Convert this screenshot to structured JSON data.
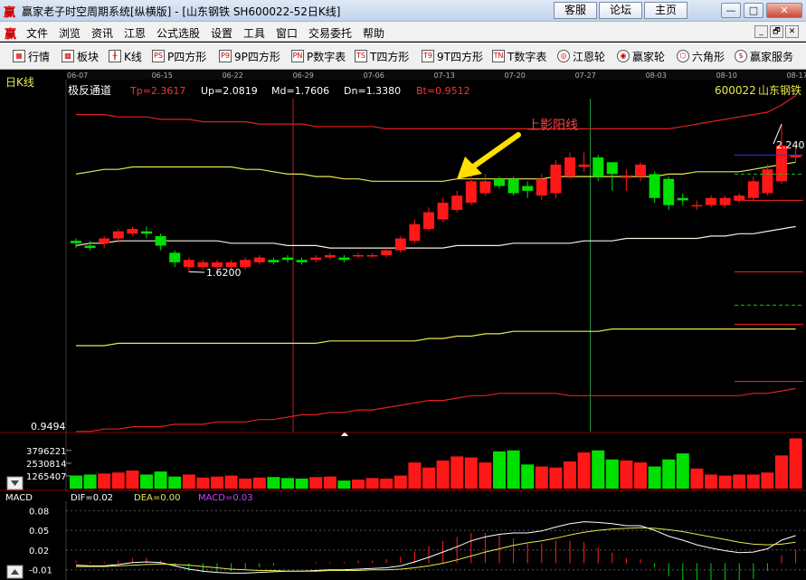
{
  "window": {
    "logo": "赢",
    "title": "赢家老子时空周期系统[纵横版] - [山东钢铁  SH600022-52日K线]",
    "buttons": [
      "客服",
      "论坛",
      "主页"
    ],
    "controls": [
      "—",
      "□",
      "✕"
    ]
  },
  "menu": {
    "logo": "赢",
    "items": [
      "文件",
      "浏览",
      "资讯",
      "江恩",
      "公式选股",
      "设置",
      "工具",
      "窗口",
      "交易委托",
      "帮助"
    ],
    "mdi": [
      "_",
      "🗗",
      "✕"
    ]
  },
  "toolbar": {
    "items": [
      {
        "icon": "grid-icon",
        "glyph": "▦",
        "label": "行情"
      },
      {
        "icon": "blocks-icon",
        "glyph": "▩",
        "label": "板块"
      },
      {
        "icon": "candles-icon",
        "glyph": "╫",
        "label": "K线"
      },
      {
        "icon": "p-square-icon",
        "glyph": "PS",
        "label": "P四方形"
      },
      {
        "icon": "p9-square-icon",
        "glyph": "P9",
        "label": "9P四方形"
      },
      {
        "icon": "pn-table-icon",
        "glyph": "PN",
        "label": "P数字表"
      },
      {
        "icon": "t-square-icon",
        "glyph": "TS",
        "label": "T四方形"
      },
      {
        "icon": "t9-square-icon",
        "glyph": "T9",
        "label": "9T四方形"
      },
      {
        "icon": "tn-table-icon",
        "glyph": "TN",
        "label": "T数字表"
      },
      {
        "icon": "gann-wheel-icon",
        "glyph": "◎",
        "label": "江恩轮"
      },
      {
        "icon": "winner-wheel-icon",
        "glyph": "◉",
        "label": "赢家轮"
      },
      {
        "icon": "hexagon-icon",
        "glyph": "⬡",
        "label": "六角形"
      },
      {
        "icon": "dollar-icon",
        "glyph": "$",
        "label": "赢家服务"
      }
    ]
  },
  "main_chart": {
    "panel_label": "日K线",
    "indicator_name": "极反通道",
    "params": [
      {
        "label": "Tp=2.3617",
        "color": "#ff3030"
      },
      {
        "label": "Up=2.0819",
        "color": "#ffffff"
      },
      {
        "label": "Md=1.7606",
        "color": "#ffffff"
      },
      {
        "label": "Dn=1.3380",
        "color": "#ffffff"
      },
      {
        "label": "Bt=0.9512",
        "color": "#ff3030"
      }
    ],
    "stock_code": "600022",
    "stock_name": "山东钢铁",
    "date_ticks": [
      "06-07",
      "06-15",
      "06-22",
      "06-29",
      "07-06",
      "07-13",
      "07-20",
      "07-27",
      "08-03",
      "08-10",
      "08-17"
    ],
    "annotation": "上影阳线",
    "low_label": "1.6200",
    "high_label": "2.240",
    "bottom_price": "0.9494",
    "colors": {
      "up": "#ff1818",
      "down": "#00e000",
      "outer": "#e02020",
      "inner": "#e8e850",
      "mid": "#f0f0e0",
      "arrow": "#ffe000",
      "annotation": "#ff4040"
    }
  },
  "chart_data": [
    {
      "type": "candlestick",
      "x": [
        "06-07",
        "06-08",
        "06-09",
        "06-12",
        "06-13",
        "06-14",
        "06-15",
        "06-16",
        "06-19",
        "06-20",
        "06-21",
        "06-22",
        "06-23",
        "06-26",
        "06-27",
        "06-28",
        "06-29",
        "06-30",
        "07-03",
        "07-04",
        "07-05",
        "07-06",
        "07-07",
        "07-10",
        "07-11",
        "07-12",
        "07-13",
        "07-14",
        "07-17",
        "07-18",
        "07-19",
        "07-20",
        "07-21",
        "07-24",
        "07-25",
        "07-26",
        "07-27",
        "07-28",
        "07-31",
        "08-01",
        "08-02",
        "08-03",
        "08-04",
        "08-07",
        "08-08",
        "08-09",
        "08-10",
        "08-11",
        "08-14",
        "08-15",
        "08-16",
        "08-17"
      ],
      "open": [
        1.75,
        1.73,
        1.74,
        1.76,
        1.78,
        1.79,
        1.77,
        1.7,
        1.64,
        1.64,
        1.64,
        1.64,
        1.64,
        1.66,
        1.67,
        1.68,
        1.67,
        1.67,
        1.68,
        1.68,
        1.69,
        1.69,
        1.69,
        1.71,
        1.75,
        1.8,
        1.84,
        1.88,
        1.91,
        1.95,
        2.01,
        2.01,
        1.98,
        1.94,
        1.95,
        2.02,
        2.06,
        2.1,
        2.08,
        2.02,
        2.02,
        2.03,
        2.01,
        1.93,
        1.9,
        1.9,
        1.9,
        1.92,
        1.93,
        1.95,
        2.0,
        2.1
      ],
      "close": [
        1.74,
        1.72,
        1.76,
        1.79,
        1.8,
        1.78,
        1.73,
        1.66,
        1.67,
        1.66,
        1.66,
        1.66,
        1.67,
        1.68,
        1.66,
        1.67,
        1.66,
        1.68,
        1.69,
        1.67,
        1.69,
        1.69,
        1.71,
        1.76,
        1.82,
        1.87,
        1.91,
        1.94,
        2.0,
        2.0,
        1.98,
        1.95,
        1.96,
        2.01,
        2.07,
        2.1,
        2.07,
        2.02,
        2.03,
        2.02,
        2.07,
        1.93,
        1.9,
        1.92,
        1.9,
        1.93,
        1.93,
        1.94,
        2.0,
        2.05,
        2.15,
        2.11
      ],
      "high": [
        1.76,
        1.75,
        1.77,
        1.8,
        1.81,
        1.81,
        1.78,
        1.71,
        1.68,
        1.67,
        1.67,
        1.67,
        1.68,
        1.69,
        1.68,
        1.69,
        1.68,
        1.69,
        1.7,
        1.69,
        1.7,
        1.7,
        1.72,
        1.77,
        1.84,
        1.89,
        1.93,
        1.96,
        2.03,
        2.03,
        2.02,
        2.02,
        2.0,
        2.03,
        2.09,
        2.12,
        2.12,
        2.11,
        2.06,
        2.05,
        2.08,
        2.04,
        2.02,
        1.95,
        1.92,
        1.94,
        1.94,
        1.95,
        2.02,
        2.07,
        2.24,
        2.14
      ],
      "low": [
        1.72,
        1.71,
        1.72,
        1.74,
        1.77,
        1.76,
        1.71,
        1.64,
        1.62,
        1.63,
        1.63,
        1.63,
        1.63,
        1.65,
        1.65,
        1.66,
        1.65,
        1.66,
        1.67,
        1.66,
        1.68,
        1.68,
        1.68,
        1.7,
        1.74,
        1.79,
        1.83,
        1.87,
        1.9,
        1.94,
        1.97,
        1.94,
        1.93,
        1.92,
        1.93,
        2.01,
        2.04,
        2.0,
        1.96,
        1.96,
        2.0,
        1.91,
        1.88,
        1.9,
        1.88,
        1.89,
        1.89,
        1.91,
        1.92,
        1.94,
        1.99,
        2.08
      ],
      "channels": {
        "Tp": [
          2.28,
          2.28,
          2.28,
          2.27,
          2.27,
          2.27,
          2.26,
          2.26,
          2.26,
          2.25,
          2.25,
          2.25,
          2.25,
          2.24,
          2.24,
          2.24,
          2.24,
          2.23,
          2.23,
          2.23,
          2.23,
          2.23,
          2.22,
          2.22,
          2.22,
          2.22,
          2.22,
          2.22,
          2.22,
          2.22,
          2.22,
          2.22,
          2.22,
          2.22,
          2.22,
          2.22,
          2.22,
          2.22,
          2.22,
          2.22,
          2.22,
          2.22,
          2.22,
          2.23,
          2.24,
          2.25,
          2.26,
          2.27,
          2.28,
          2.29,
          2.32,
          2.36
        ],
        "Up": [
          2.03,
          2.04,
          2.05,
          2.05,
          2.06,
          2.06,
          2.06,
          2.06,
          2.06,
          2.06,
          2.06,
          2.06,
          2.05,
          2.05,
          2.04,
          2.03,
          2.03,
          2.02,
          2.02,
          2.01,
          2.01,
          2.0,
          2.0,
          2.0,
          2.0,
          2.0,
          2.0,
          2.01,
          2.01,
          2.01,
          2.01,
          2.01,
          2.01,
          2.01,
          2.02,
          2.02,
          2.02,
          2.02,
          2.02,
          2.02,
          2.02,
          2.02,
          2.03,
          2.03,
          2.04,
          2.04,
          2.04,
          2.04,
          2.05,
          2.06,
          2.07,
          2.08
        ],
        "Md": [
          1.73,
          1.74,
          1.74,
          1.75,
          1.75,
          1.75,
          1.75,
          1.75,
          1.75,
          1.75,
          1.75,
          1.74,
          1.74,
          1.74,
          1.74,
          1.73,
          1.73,
          1.73,
          1.72,
          1.72,
          1.72,
          1.72,
          1.72,
          1.72,
          1.72,
          1.72,
          1.72,
          1.73,
          1.73,
          1.73,
          1.73,
          1.74,
          1.74,
          1.74,
          1.74,
          1.74,
          1.75,
          1.75,
          1.75,
          1.76,
          1.76,
          1.76,
          1.76,
          1.76,
          1.76,
          1.77,
          1.77,
          1.78,
          1.78,
          1.79,
          1.8,
          1.81
        ],
        "Dn": [
          1.31,
          1.31,
          1.31,
          1.32,
          1.32,
          1.32,
          1.32,
          1.32,
          1.32,
          1.32,
          1.32,
          1.32,
          1.32,
          1.32,
          1.32,
          1.32,
          1.32,
          1.32,
          1.33,
          1.33,
          1.33,
          1.33,
          1.33,
          1.33,
          1.33,
          1.34,
          1.34,
          1.35,
          1.35,
          1.36,
          1.36,
          1.37,
          1.37,
          1.37,
          1.37,
          1.37,
          1.37,
          1.37,
          1.38,
          1.38,
          1.38,
          1.38,
          1.38,
          1.38,
          1.38,
          1.38,
          1.38,
          1.38,
          1.38,
          1.38,
          1.38,
          1.38
        ],
        "Bt": [
          0.95,
          0.95,
          0.96,
          0.96,
          0.97,
          0.97,
          0.97,
          0.98,
          0.98,
          0.98,
          0.99,
          0.99,
          0.99,
          1.0,
          1.0,
          1.01,
          1.02,
          1.02,
          1.03,
          1.03,
          1.04,
          1.04,
          1.05,
          1.06,
          1.07,
          1.08,
          1.08,
          1.09,
          1.1,
          1.1,
          1.11,
          1.11,
          1.11,
          1.11,
          1.11,
          1.1,
          1.1,
          1.1,
          1.1,
          1.1,
          1.1,
          1.1,
          1.1,
          1.1,
          1.1,
          1.1,
          1.1,
          1.1,
          1.11,
          1.11,
          1.12,
          1.13
        ]
      },
      "ylim": [
        0.9494,
        2.4
      ]
    },
    {
      "type": "bar",
      "title": "",
      "yticks": [
        "3796221",
        "2530814",
        "1265407"
      ],
      "ylim": [
        0,
        5400000
      ],
      "values": [
        1300000,
        1400000,
        1500000,
        1600000,
        1800000,
        1400000,
        1700000,
        1200000,
        1400000,
        1100000,
        1200000,
        1300000,
        1000000,
        1100000,
        1150000,
        1050000,
        1000000,
        1150000,
        1200000,
        800000,
        900000,
        1050000,
        1000000,
        1300000,
        2600000,
        2100000,
        2800000,
        3200000,
        3100000,
        2600000,
        3700000,
        3800000,
        2400000,
        2200000,
        2100000,
        2700000,
        3600000,
        3800000,
        2900000,
        2800000,
        2600000,
        2200000,
        2900000,
        3500000,
        2000000,
        1400000,
        1300000,
        1400000,
        1400000,
        1600000,
        3300000,
        5000000
      ]
    },
    {
      "type": "macd",
      "labels": {
        "name": "MACD",
        "dif": "DIF=0.02",
        "dea": "DEA=0.00",
        "macd": "MACD=0.03"
      },
      "yticks": [
        "0.08",
        "0.05",
        "0.02",
        "-0.01"
      ],
      "ylim": [
        -0.02,
        0.09
      ],
      "dif": [
        -0.003,
        -0.004,
        -0.004,
        -0.002,
        0.001,
        0.002,
        0.001,
        -0.004,
        -0.009,
        -0.012,
        -0.014,
        -0.015,
        -0.015,
        -0.014,
        -0.013,
        -0.012,
        -0.012,
        -0.011,
        -0.01,
        -0.01,
        -0.009,
        -0.008,
        -0.007,
        -0.004,
        0.002,
        0.009,
        0.017,
        0.025,
        0.034,
        0.04,
        0.044,
        0.046,
        0.046,
        0.049,
        0.055,
        0.06,
        0.063,
        0.062,
        0.06,
        0.057,
        0.057,
        0.05,
        0.041,
        0.035,
        0.028,
        0.023,
        0.019,
        0.016,
        0.017,
        0.022,
        0.035,
        0.042
      ],
      "dea": [
        -0.005,
        -0.005,
        -0.005,
        -0.004,
        -0.003,
        -0.002,
        -0.001,
        -0.002,
        -0.003,
        -0.005,
        -0.007,
        -0.009,
        -0.01,
        -0.011,
        -0.011,
        -0.012,
        -0.012,
        -0.012,
        -0.011,
        -0.011,
        -0.011,
        -0.01,
        -0.01,
        -0.009,
        -0.007,
        -0.004,
        0.0,
        0.005,
        0.011,
        0.017,
        0.022,
        0.027,
        0.031,
        0.034,
        0.038,
        0.043,
        0.047,
        0.05,
        0.052,
        0.053,
        0.054,
        0.053,
        0.051,
        0.048,
        0.044,
        0.04,
        0.036,
        0.032,
        0.029,
        0.028,
        0.029,
        0.032
      ]
    }
  ]
}
